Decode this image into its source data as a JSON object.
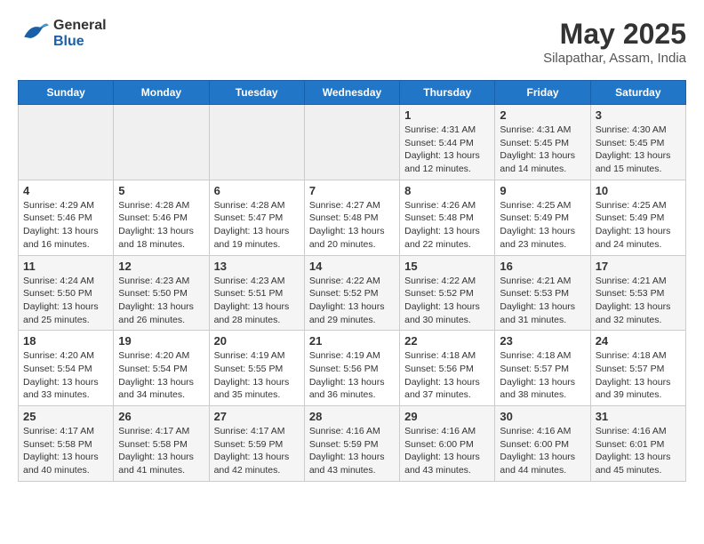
{
  "header": {
    "logo_general": "General",
    "logo_blue": "Blue",
    "month_title": "May 2025",
    "location": "Silapathar, Assam, India"
  },
  "weekdays": [
    "Sunday",
    "Monday",
    "Tuesday",
    "Wednesday",
    "Thursday",
    "Friday",
    "Saturday"
  ],
  "weeks": [
    [
      {
        "day": "",
        "empty": true
      },
      {
        "day": "",
        "empty": true
      },
      {
        "day": "",
        "empty": true
      },
      {
        "day": "",
        "empty": true
      },
      {
        "day": "1",
        "sunrise": "4:31 AM",
        "sunset": "5:44 PM",
        "daylight": "13 hours and 12 minutes."
      },
      {
        "day": "2",
        "sunrise": "4:31 AM",
        "sunset": "5:45 PM",
        "daylight": "13 hours and 14 minutes."
      },
      {
        "day": "3",
        "sunrise": "4:30 AM",
        "sunset": "5:45 PM",
        "daylight": "13 hours and 15 minutes."
      }
    ],
    [
      {
        "day": "4",
        "sunrise": "4:29 AM",
        "sunset": "5:46 PM",
        "daylight": "13 hours and 16 minutes."
      },
      {
        "day": "5",
        "sunrise": "4:28 AM",
        "sunset": "5:46 PM",
        "daylight": "13 hours and 18 minutes."
      },
      {
        "day": "6",
        "sunrise": "4:28 AM",
        "sunset": "5:47 PM",
        "daylight": "13 hours and 19 minutes."
      },
      {
        "day": "7",
        "sunrise": "4:27 AM",
        "sunset": "5:48 PM",
        "daylight": "13 hours and 20 minutes."
      },
      {
        "day": "8",
        "sunrise": "4:26 AM",
        "sunset": "5:48 PM",
        "daylight": "13 hours and 22 minutes."
      },
      {
        "day": "9",
        "sunrise": "4:25 AM",
        "sunset": "5:49 PM",
        "daylight": "13 hours and 23 minutes."
      },
      {
        "day": "10",
        "sunrise": "4:25 AM",
        "sunset": "5:49 PM",
        "daylight": "13 hours and 24 minutes."
      }
    ],
    [
      {
        "day": "11",
        "sunrise": "4:24 AM",
        "sunset": "5:50 PM",
        "daylight": "13 hours and 25 minutes."
      },
      {
        "day": "12",
        "sunrise": "4:23 AM",
        "sunset": "5:50 PM",
        "daylight": "13 hours and 26 minutes."
      },
      {
        "day": "13",
        "sunrise": "4:23 AM",
        "sunset": "5:51 PM",
        "daylight": "13 hours and 28 minutes."
      },
      {
        "day": "14",
        "sunrise": "4:22 AM",
        "sunset": "5:52 PM",
        "daylight": "13 hours and 29 minutes."
      },
      {
        "day": "15",
        "sunrise": "4:22 AM",
        "sunset": "5:52 PM",
        "daylight": "13 hours and 30 minutes."
      },
      {
        "day": "16",
        "sunrise": "4:21 AM",
        "sunset": "5:53 PM",
        "daylight": "13 hours and 31 minutes."
      },
      {
        "day": "17",
        "sunrise": "4:21 AM",
        "sunset": "5:53 PM",
        "daylight": "13 hours and 32 minutes."
      }
    ],
    [
      {
        "day": "18",
        "sunrise": "4:20 AM",
        "sunset": "5:54 PM",
        "daylight": "13 hours and 33 minutes."
      },
      {
        "day": "19",
        "sunrise": "4:20 AM",
        "sunset": "5:54 PM",
        "daylight": "13 hours and 34 minutes."
      },
      {
        "day": "20",
        "sunrise": "4:19 AM",
        "sunset": "5:55 PM",
        "daylight": "13 hours and 35 minutes."
      },
      {
        "day": "21",
        "sunrise": "4:19 AM",
        "sunset": "5:56 PM",
        "daylight": "13 hours and 36 minutes."
      },
      {
        "day": "22",
        "sunrise": "4:18 AM",
        "sunset": "5:56 PM",
        "daylight": "13 hours and 37 minutes."
      },
      {
        "day": "23",
        "sunrise": "4:18 AM",
        "sunset": "5:57 PM",
        "daylight": "13 hours and 38 minutes."
      },
      {
        "day": "24",
        "sunrise": "4:18 AM",
        "sunset": "5:57 PM",
        "daylight": "13 hours and 39 minutes."
      }
    ],
    [
      {
        "day": "25",
        "sunrise": "4:17 AM",
        "sunset": "5:58 PM",
        "daylight": "13 hours and 40 minutes."
      },
      {
        "day": "26",
        "sunrise": "4:17 AM",
        "sunset": "5:58 PM",
        "daylight": "13 hours and 41 minutes."
      },
      {
        "day": "27",
        "sunrise": "4:17 AM",
        "sunset": "5:59 PM",
        "daylight": "13 hours and 42 minutes."
      },
      {
        "day": "28",
        "sunrise": "4:16 AM",
        "sunset": "5:59 PM",
        "daylight": "13 hours and 43 minutes."
      },
      {
        "day": "29",
        "sunrise": "4:16 AM",
        "sunset": "6:00 PM",
        "daylight": "13 hours and 43 minutes."
      },
      {
        "day": "30",
        "sunrise": "4:16 AM",
        "sunset": "6:00 PM",
        "daylight": "13 hours and 44 minutes."
      },
      {
        "day": "31",
        "sunrise": "4:16 AM",
        "sunset": "6:01 PM",
        "daylight": "13 hours and 45 minutes."
      }
    ]
  ]
}
